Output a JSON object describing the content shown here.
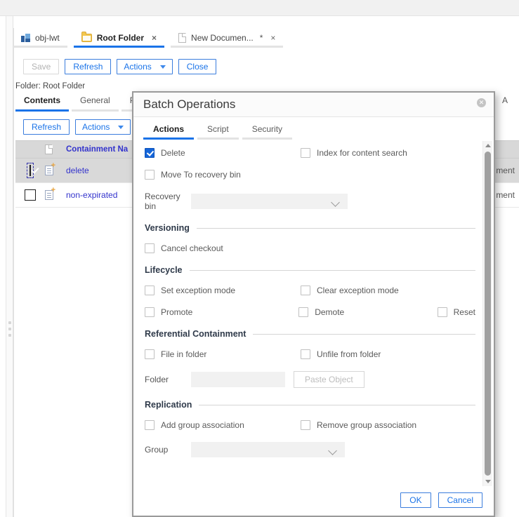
{
  "window": {
    "tabs": [
      {
        "label": "obj-lwt",
        "icon": "object-icon",
        "active": false,
        "closable": false,
        "dirty": false
      },
      {
        "label": "Root Folder",
        "icon": "folder-icon",
        "active": true,
        "closable": true,
        "dirty": false
      },
      {
        "label": "New Documen...",
        "icon": "document-icon",
        "active": false,
        "closable": true,
        "dirty": true
      }
    ],
    "close_glyph": "×",
    "dirty_glyph": "*"
  },
  "toolbar": {
    "save_label": "Save",
    "refresh_label": "Refresh",
    "actions_label": "Actions",
    "close_label": "Close"
  },
  "breadcrumb": {
    "text": "Folder: Root Folder"
  },
  "object_tabs": [
    {
      "label": "Contents",
      "active": true
    },
    {
      "label": "General",
      "active": false
    },
    {
      "label": "Pr",
      "active": false
    }
  ],
  "right_tab_fragment": "A",
  "subbar": {
    "refresh_label": "Refresh",
    "actions_label": "Actions"
  },
  "grid": {
    "columns": [
      "",
      "",
      "Containment Na",
      ""
    ],
    "rows": [
      {
        "checked": true,
        "focused": true,
        "name": "delete",
        "type_fragment": "ment",
        "selected": true
      },
      {
        "checked": false,
        "focused": false,
        "name": "non-expirated",
        "type_fragment": "ment",
        "selected": false
      }
    ]
  },
  "dialog": {
    "title": "Batch Operations",
    "close_glyph": "✕",
    "tabs": [
      {
        "label": "Actions",
        "active": true
      },
      {
        "label": "Script",
        "active": false
      },
      {
        "label": "Security",
        "active": false
      }
    ],
    "top_options": [
      {
        "label": "Delete",
        "checked": true,
        "column": "left"
      },
      {
        "label": "Index for content search",
        "checked": false,
        "column": "right"
      },
      {
        "label": "Move To recovery bin",
        "checked": false,
        "column": "left"
      }
    ],
    "recovery_bin": {
      "label": "Recovery bin",
      "value": "",
      "placeholder": ""
    },
    "sections": [
      {
        "title": "Versioning",
        "options": [
          {
            "label": "Cancel checkout",
            "checked": false,
            "column": "left"
          }
        ]
      },
      {
        "title": "Lifecycle",
        "options": [
          {
            "label": "Set exception mode",
            "checked": false,
            "column": "left"
          },
          {
            "label": "Clear exception mode",
            "checked": false,
            "column": "right"
          },
          {
            "label": "Promote",
            "checked": false,
            "column": "left"
          },
          {
            "label": "Demote",
            "checked": false,
            "column": "right"
          },
          {
            "label": "Reset",
            "checked": false,
            "column": "far-right"
          }
        ]
      },
      {
        "title": "Referential Containment",
        "options": [
          {
            "label": "File in folder",
            "checked": false,
            "column": "left"
          },
          {
            "label": "Unfile from folder",
            "checked": false,
            "column": "right"
          }
        ]
      },
      {
        "title": "Replication",
        "options": [
          {
            "label": "Add group association",
            "checked": false,
            "column": "left"
          },
          {
            "label": "Remove group association",
            "checked": false,
            "column": "right"
          }
        ]
      }
    ],
    "folder_field": {
      "label": "Folder",
      "value": "",
      "paste_label": "Paste Object"
    },
    "group_field": {
      "label": "Group",
      "value": ""
    },
    "footer": {
      "ok_label": "OK",
      "cancel_label": "Cancel"
    }
  },
  "colors": {
    "accent": "#1a73e8",
    "checkbox_checked": "#1565d8",
    "link": "#3333cc",
    "section_title": "#2f3a4a"
  }
}
